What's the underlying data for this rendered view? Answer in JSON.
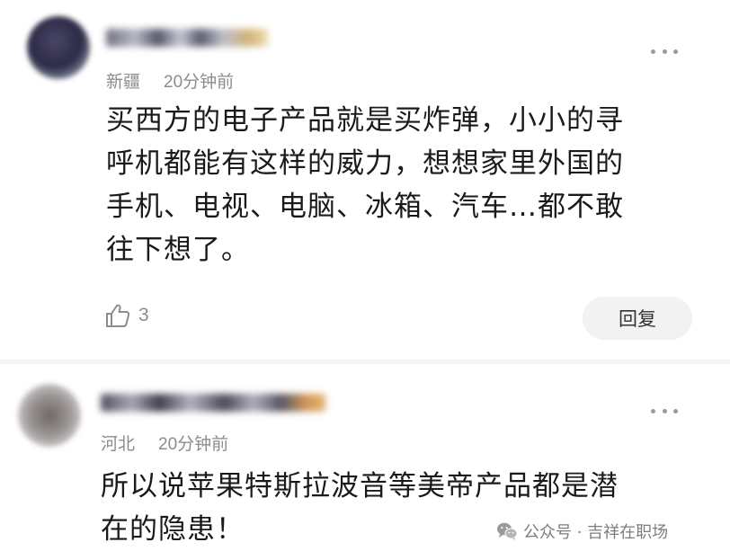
{
  "comments": [
    {
      "location": "新疆",
      "time": "20分钟前",
      "text_lines": [
        "买西方的电子产品就是买炸弹，小小的寻",
        "呼机都能有这样的威力，想想家里外国的",
        "手机、电视、电脑、冰箱、汽车…都不敢",
        "往下想了。"
      ],
      "like_count": "3",
      "reply_label": "回复"
    },
    {
      "location": "河北",
      "time": "20分钟前",
      "text_lines": [
        "所以说苹果特斯拉波音等美帝产品都是潜",
        "在的隐患！"
      ]
    }
  ],
  "watermark": {
    "text": "公众号 · 吉祥在职场",
    "icon": "wechat-icon"
  },
  "icons": {
    "more": "more-dots-icon",
    "like": "thumbs-up-icon"
  }
}
